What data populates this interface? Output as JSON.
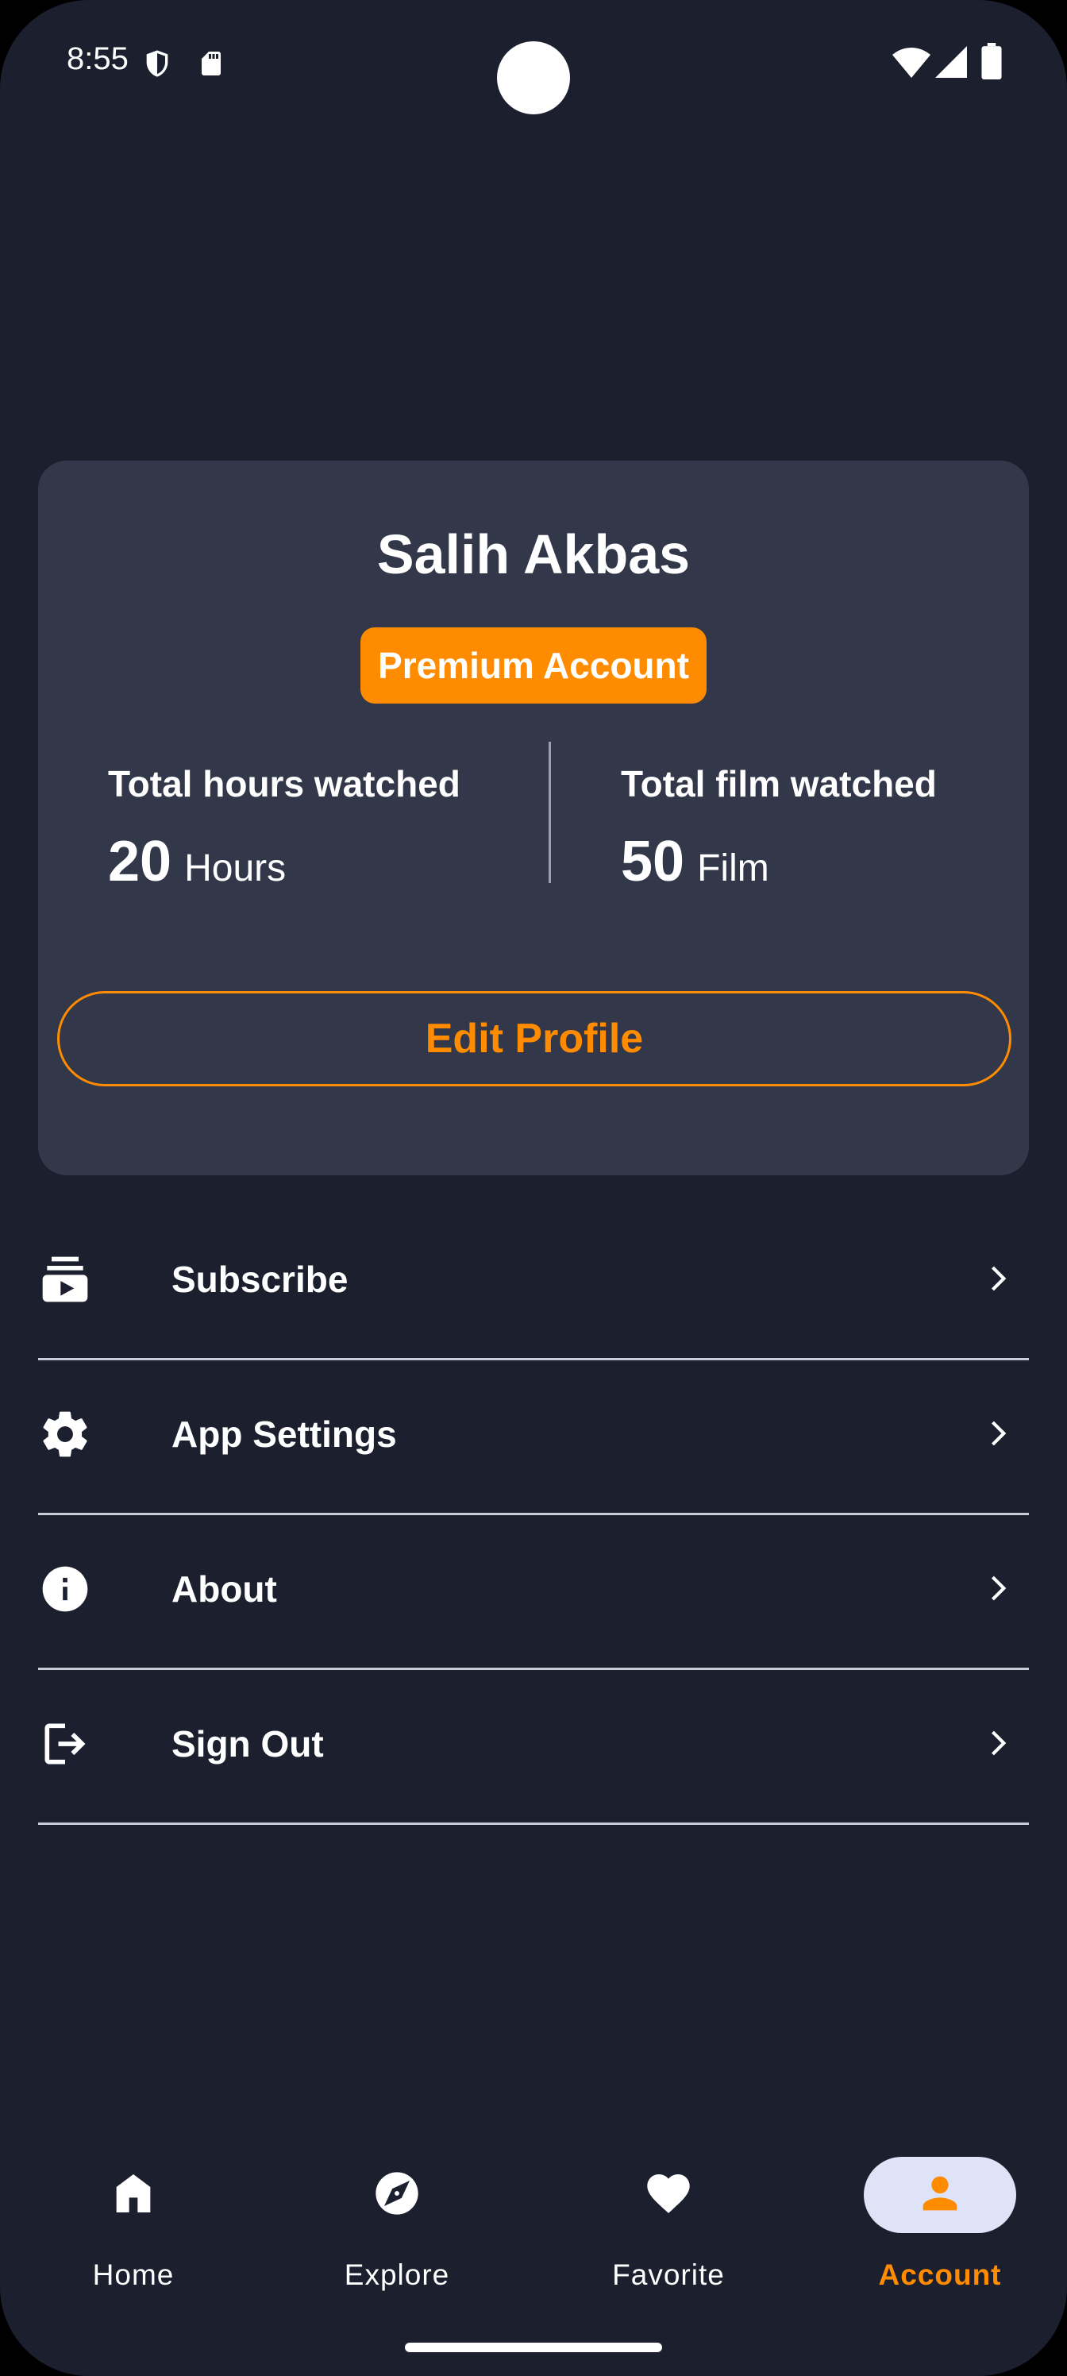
{
  "status_bar": {
    "time": "8:55",
    "icons": [
      "shield-icon",
      "sd-card-icon",
      "wifi-icon",
      "signal-icon",
      "battery-icon"
    ]
  },
  "profile": {
    "name": "Salih Akbas",
    "badge": "Premium Account",
    "stats": [
      {
        "label": "Total hours watched",
        "value": "20",
        "unit": "Hours"
      },
      {
        "label": "Total film watched",
        "value": "50",
        "unit": "Film"
      }
    ],
    "edit_button_label": "Edit Profile"
  },
  "menu": {
    "items": [
      {
        "label": "Subscribe",
        "icon": "subscriptions-icon"
      },
      {
        "label": "App Settings",
        "icon": "gear-icon"
      },
      {
        "label": "About",
        "icon": "info-icon"
      },
      {
        "label": "Sign Out",
        "icon": "logout-icon"
      }
    ]
  },
  "bottom_nav": {
    "items": [
      {
        "label": "Home",
        "icon": "home-icon",
        "active": false
      },
      {
        "label": "Explore",
        "icon": "compass-icon",
        "active": false
      },
      {
        "label": "Favorite",
        "icon": "heart-icon",
        "active": false
      },
      {
        "label": "Account",
        "icon": "person-icon",
        "active": true
      }
    ]
  },
  "colors": {
    "background": "#1b1f2e",
    "card": "#323749",
    "accent": "#ff8c00",
    "active_nav_pill": "#dfe3f7"
  }
}
